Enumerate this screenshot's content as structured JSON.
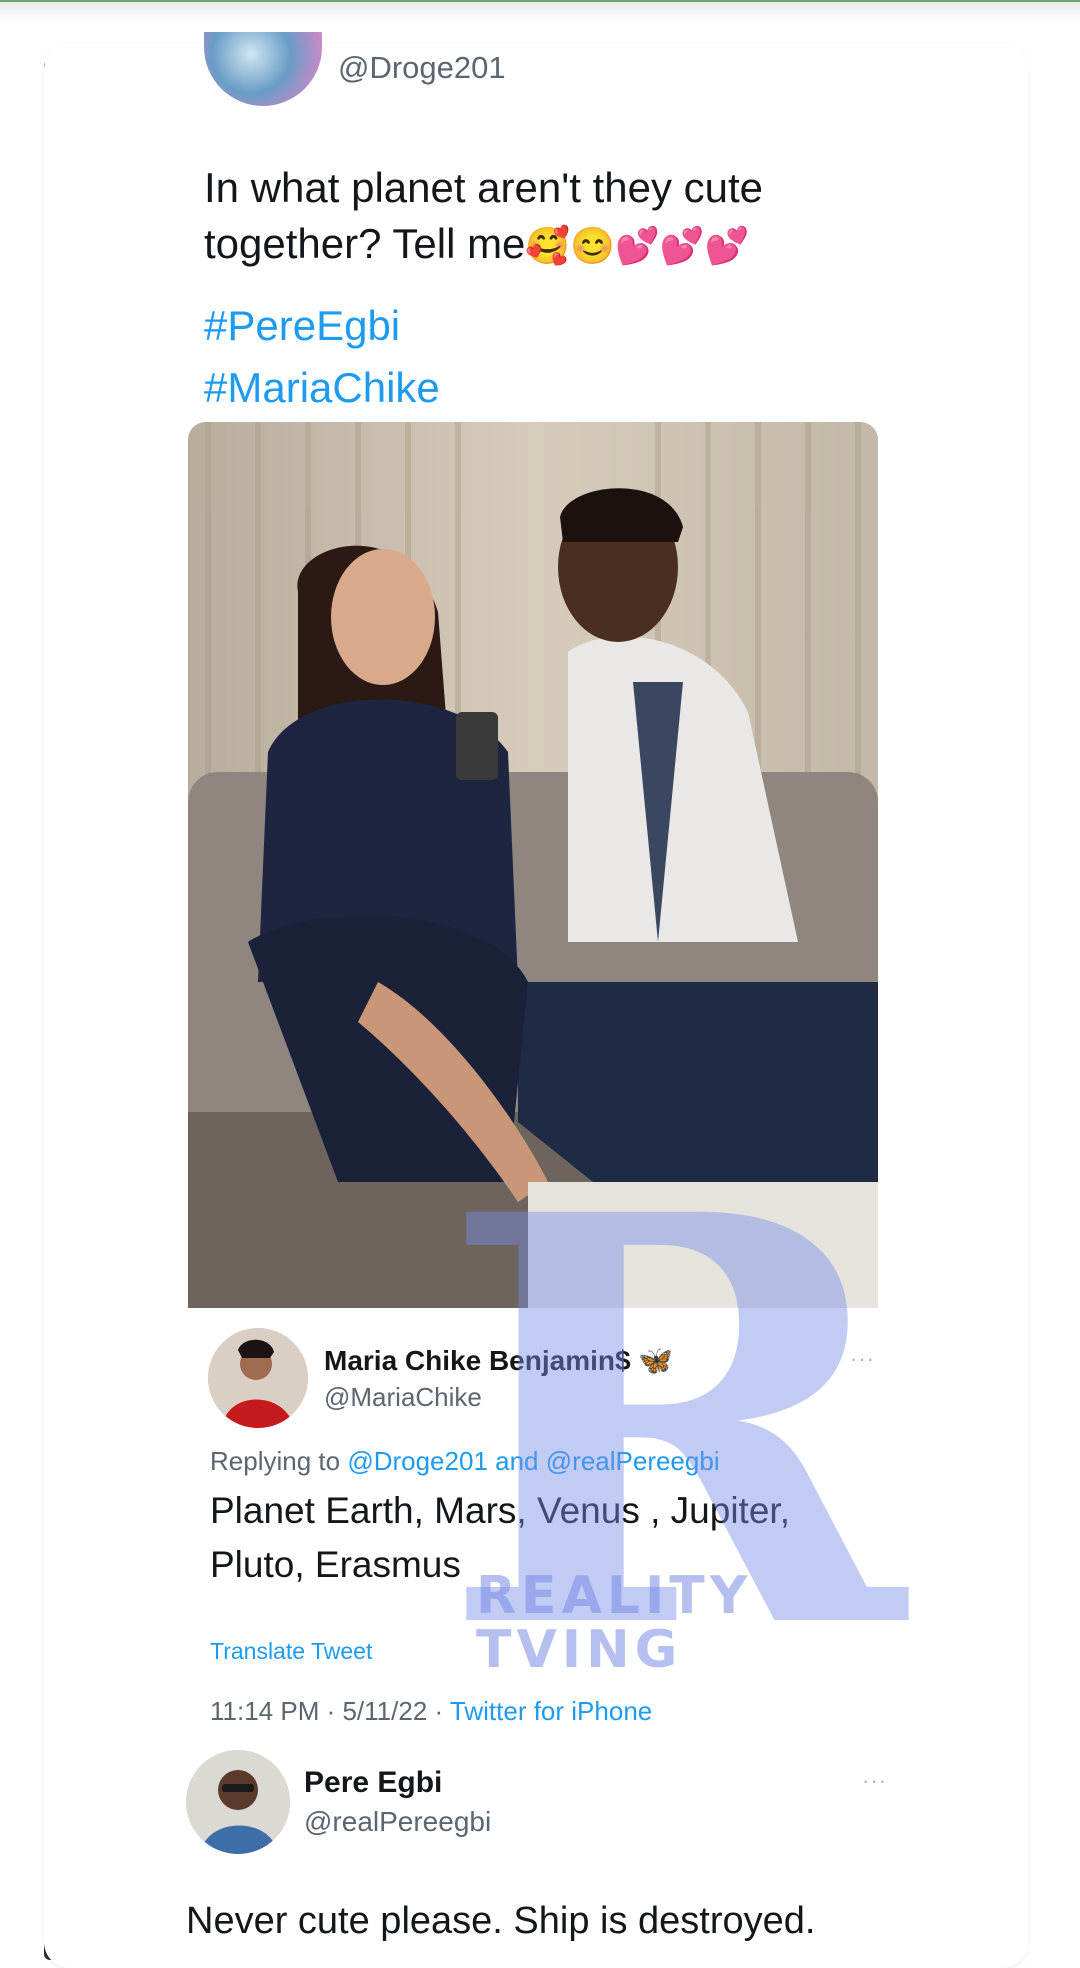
{
  "top_tweet": {
    "handle": "@Droge201",
    "text": "In what planet aren't they cute together? Tell me",
    "emojis": "🥰😊💕💕💕",
    "hashtags": [
      "#PereEgbi",
      "#MariaChike"
    ]
  },
  "reply_maria": {
    "name": "Maria Chike Benjamin$",
    "badge": "🦋",
    "handle": "@MariaChike",
    "replying_prefix": "Replying to",
    "mention_1": "@Droge201",
    "and_word": "and",
    "mention_2": "@realPereegbi",
    "text": "Planet Earth, Mars, Venus , Jupiter, Pluto, Erasmus",
    "translate": "Translate Tweet",
    "timestamp": "11:14 PM · 5/11/22 · ",
    "source": "Twitter for iPhone",
    "more": "···"
  },
  "reply_pere": {
    "name": "Pere Egbi",
    "handle": "@realPereegbi",
    "text": "Never cute please. Ship is destroyed.",
    "more": "···"
  },
  "watermark": {
    "letter": "R",
    "line1": "REALITY",
    "line2": "TVING"
  },
  "colors": {
    "link": "#1d9bf0",
    "text": "#14171a",
    "muted": "#5b6670",
    "watermark": "#7a8ce6",
    "accent_strip": "#b21d17"
  },
  "icons": {
    "more": "more-dots-icon",
    "badge": "butterfly-icon"
  }
}
